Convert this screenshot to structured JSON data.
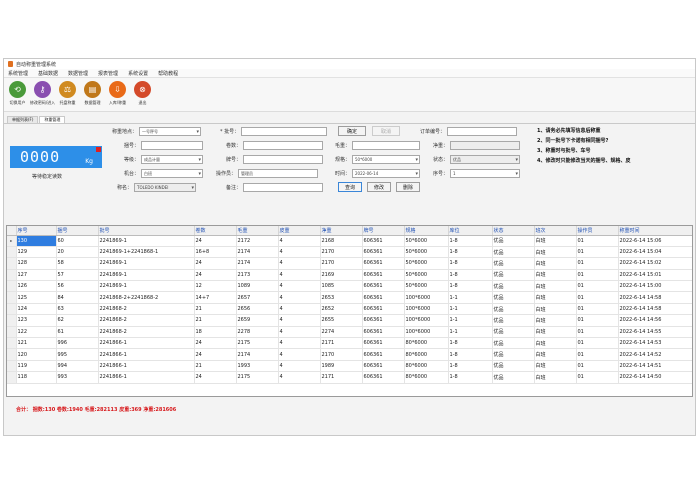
{
  "window": {
    "title": "自动称重管理系统"
  },
  "menu": [
    "系统管理",
    "基础数据",
    "数据管理",
    "报表管理",
    "系统设置",
    "帮助教程"
  ],
  "toolbar": [
    {
      "label": "切换用户",
      "icon": "switch-user-icon",
      "color": "#4a9a3a",
      "glyph": "⟲"
    },
    {
      "label": "修改密码/进入",
      "icon": "password-icon",
      "color": "#8a4fb0",
      "glyph": "⚷"
    },
    {
      "label": "托盘称重",
      "icon": "weighing-icon",
      "color": "#d08a20",
      "glyph": "⚖"
    },
    {
      "label": "数据管理",
      "icon": "database-icon",
      "color": "#c0781a",
      "glyph": "▤"
    },
    {
      "label": "入库/称重",
      "icon": "stock-in-icon",
      "color": "#e96a18",
      "glyph": "⇩"
    },
    {
      "label": "退出",
      "icon": "exit-icon",
      "color": "#d44a2a",
      "glyph": "⊗"
    }
  ],
  "tabs": [
    "单据列表(F)",
    "称重管理"
  ],
  "display": {
    "weight": "0000",
    "unit": "Kg",
    "status": "等待稳定读数"
  },
  "form": {
    "scale_label": "称重地点：",
    "scale_value": "一号秤号",
    "batch_label": "* 批号：",
    "batch_value": "",
    "confirm": "确定",
    "cancel": "取消",
    "order_label": "订单编号：",
    "order_value": "",
    "reel_label": "捆号：",
    "reel_value": "",
    "roll_label": "卷数：",
    "roll_value": "",
    "gross_label": "毛重：",
    "gross_value": "",
    "net_label": "净重：",
    "net_value": "",
    "grade_label": "等级：",
    "grade_value": "成品计量",
    "brand_label": "牌号：",
    "brand_value": "",
    "spec_label": "规格：",
    "spec_value": "50*6000",
    "quality_label": "状态：",
    "quality_value": "优品",
    "source_label": "机台：",
    "source_value": "白班",
    "operator_label": "操作员：",
    "operator_value": "管理员",
    "time_label": "时间：",
    "time_value": "2022-06-14",
    "remark_label": "序号：",
    "remark_value": "1",
    "scale_name_label": "称名：",
    "scale_name_value": "TOLEDO KINDEI",
    "memo_label": "备注：",
    "memo_value": "",
    "query": "查询",
    "modify": "修改",
    "delete": "删除"
  },
  "notes": [
    "1、请务必先填写信息后称重",
    "2、同一批号下卡诺有相同捆号?",
    "3、称重时与批号、车号",
    "4、修改时只能修改当天的捆号、规格、皮"
  ],
  "table": {
    "columns": [
      "序号",
      "捆号",
      "批号",
      "卷数",
      "毛重",
      "皮重",
      "净重",
      "牌号",
      "规格",
      "库位",
      "状态",
      "班次",
      "操作员",
      "称重时间"
    ],
    "rows": [
      [
        "130",
        "60",
        "2241869-1",
        "24",
        "2172",
        "4",
        "2168",
        "606361",
        "50*6000",
        "1-8",
        "优品",
        "白班",
        "01",
        "2022-6-14 15:06"
      ],
      [
        "129",
        "20",
        "2241869-1+2241868-1",
        "16+8",
        "2174",
        "4",
        "2170",
        "606361",
        "50*6000",
        "1-8",
        "优品",
        "白班",
        "01",
        "2022-6-14 15:04"
      ],
      [
        "128",
        "58",
        "2241869-1",
        "24",
        "2174",
        "4",
        "2170",
        "606361",
        "50*6000",
        "1-8",
        "优品",
        "白班",
        "01",
        "2022-6-14 15:02"
      ],
      [
        "127",
        "57",
        "2241869-1",
        "24",
        "2173",
        "4",
        "2169",
        "606361",
        "50*6000",
        "1-8",
        "优品",
        "白班",
        "01",
        "2022-6-14 15:01"
      ],
      [
        "126",
        "56",
        "2241869-1",
        "12",
        "1089",
        "4",
        "1085",
        "606361",
        "50*6000",
        "1-8",
        "优品",
        "白班",
        "01",
        "2022-6-14 15:00"
      ],
      [
        "125",
        "84",
        "2241868-2+2241868-2",
        "14+7",
        "2657",
        "4",
        "2653",
        "606361",
        "100*6000",
        "1-1",
        "优品",
        "白班",
        "01",
        "2022-6-14 14:58"
      ],
      [
        "124",
        "63",
        "2241868-2",
        "21",
        "2656",
        "4",
        "2652",
        "606361",
        "100*6000",
        "1-1",
        "优品",
        "白班",
        "01",
        "2022-6-14 14:58"
      ],
      [
        "123",
        "62",
        "2241868-2",
        "21",
        "2659",
        "4",
        "2655",
        "606361",
        "100*6000",
        "1-1",
        "优品",
        "白班",
        "01",
        "2022-6-14 14:56"
      ],
      [
        "122",
        "61",
        "2241868-2",
        "18",
        "2278",
        "4",
        "2274",
        "606361",
        "100*6000",
        "1-1",
        "优品",
        "白班",
        "01",
        "2022-6-14 14:55"
      ],
      [
        "121",
        "996",
        "2241866-1",
        "24",
        "2175",
        "4",
        "2171",
        "606361",
        "80*6000",
        "1-8",
        "优品",
        "白班",
        "01",
        "2022-6-14 14:53"
      ],
      [
        "120",
        "995",
        "2241866-1",
        "24",
        "2174",
        "4",
        "2170",
        "606361",
        "80*6000",
        "1-8",
        "优品",
        "白班",
        "01",
        "2022-6-14 14:52"
      ],
      [
        "119",
        "994",
        "2241866-1",
        "21",
        "1993",
        "4",
        "1989",
        "606361",
        "80*6000",
        "1-8",
        "优品",
        "白班",
        "01",
        "2022-6-14 14:51"
      ],
      [
        "118",
        "993",
        "2241866-1",
        "24",
        "2175",
        "4",
        "2171",
        "606361",
        "80*6000",
        "1-8",
        "优品",
        "白班",
        "01",
        "2022-6-14 14:50"
      ]
    ]
  },
  "summary": "合计： 捆数:130 卷数:1940 毛重:282113 皮重:369 净重:281606"
}
